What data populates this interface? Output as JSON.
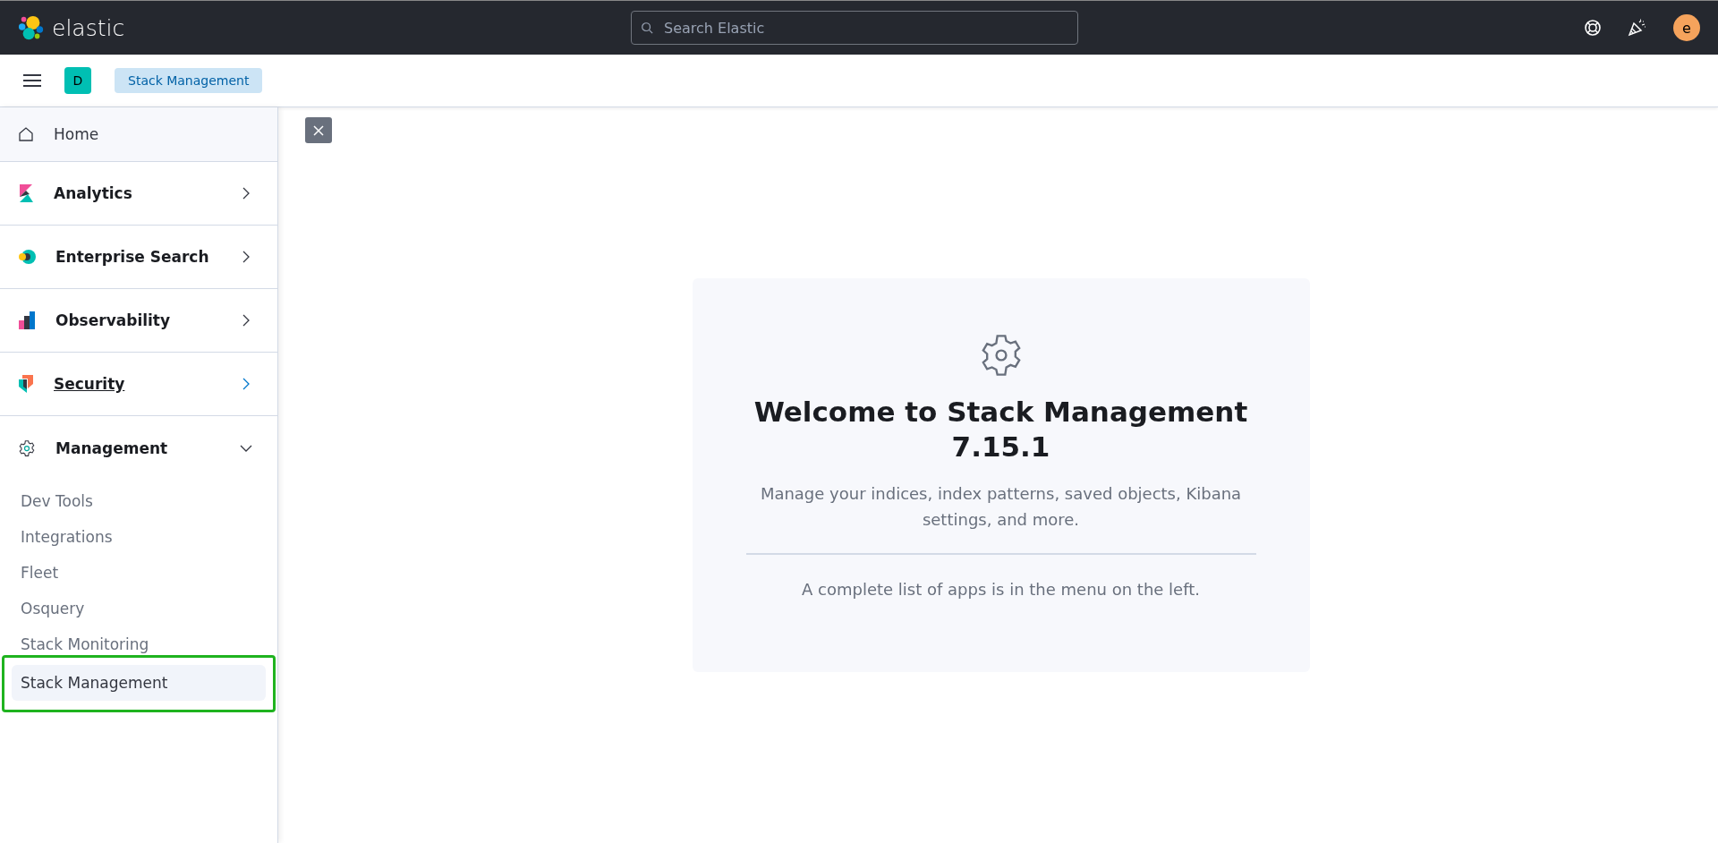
{
  "header": {
    "logo_text": "elastic",
    "search": {
      "placeholder": "Search Elastic"
    },
    "avatar": "e"
  },
  "breadcrumb_bar": {
    "space_badge": "D",
    "breadcrumb": "Stack Management"
  },
  "sidebar": {
    "items": [
      {
        "kind": "link",
        "label": "Home"
      },
      {
        "kind": "category",
        "label": "Analytics",
        "expanded": false,
        "hovered": false
      },
      {
        "kind": "category",
        "label": "Enterprise Search",
        "expanded": false,
        "hovered": false
      },
      {
        "kind": "category",
        "label": "Observability",
        "expanded": false,
        "hovered": false
      },
      {
        "kind": "category",
        "label": "Security",
        "expanded": false,
        "hovered": true
      },
      {
        "kind": "category",
        "label": "Management",
        "expanded": true,
        "hovered": false,
        "children": [
          {
            "label": "Dev Tools",
            "selected": false,
            "highlighted": false
          },
          {
            "label": "Integrations",
            "selected": false,
            "highlighted": false
          },
          {
            "label": "Fleet",
            "selected": false,
            "highlighted": false
          },
          {
            "label": "Osquery",
            "selected": false,
            "highlighted": false
          },
          {
            "label": "Stack Monitoring",
            "selected": false,
            "highlighted": false
          },
          {
            "label": "Stack Management",
            "selected": true,
            "highlighted": true
          }
        ]
      }
    ]
  },
  "welcome_card": {
    "title": "Welcome to Stack Management 7.15.1",
    "description": "Manage your indices, index patterns, saved objects, Kibana settings, and more.",
    "footer": "A complete list of apps is in the menu on the left."
  }
}
